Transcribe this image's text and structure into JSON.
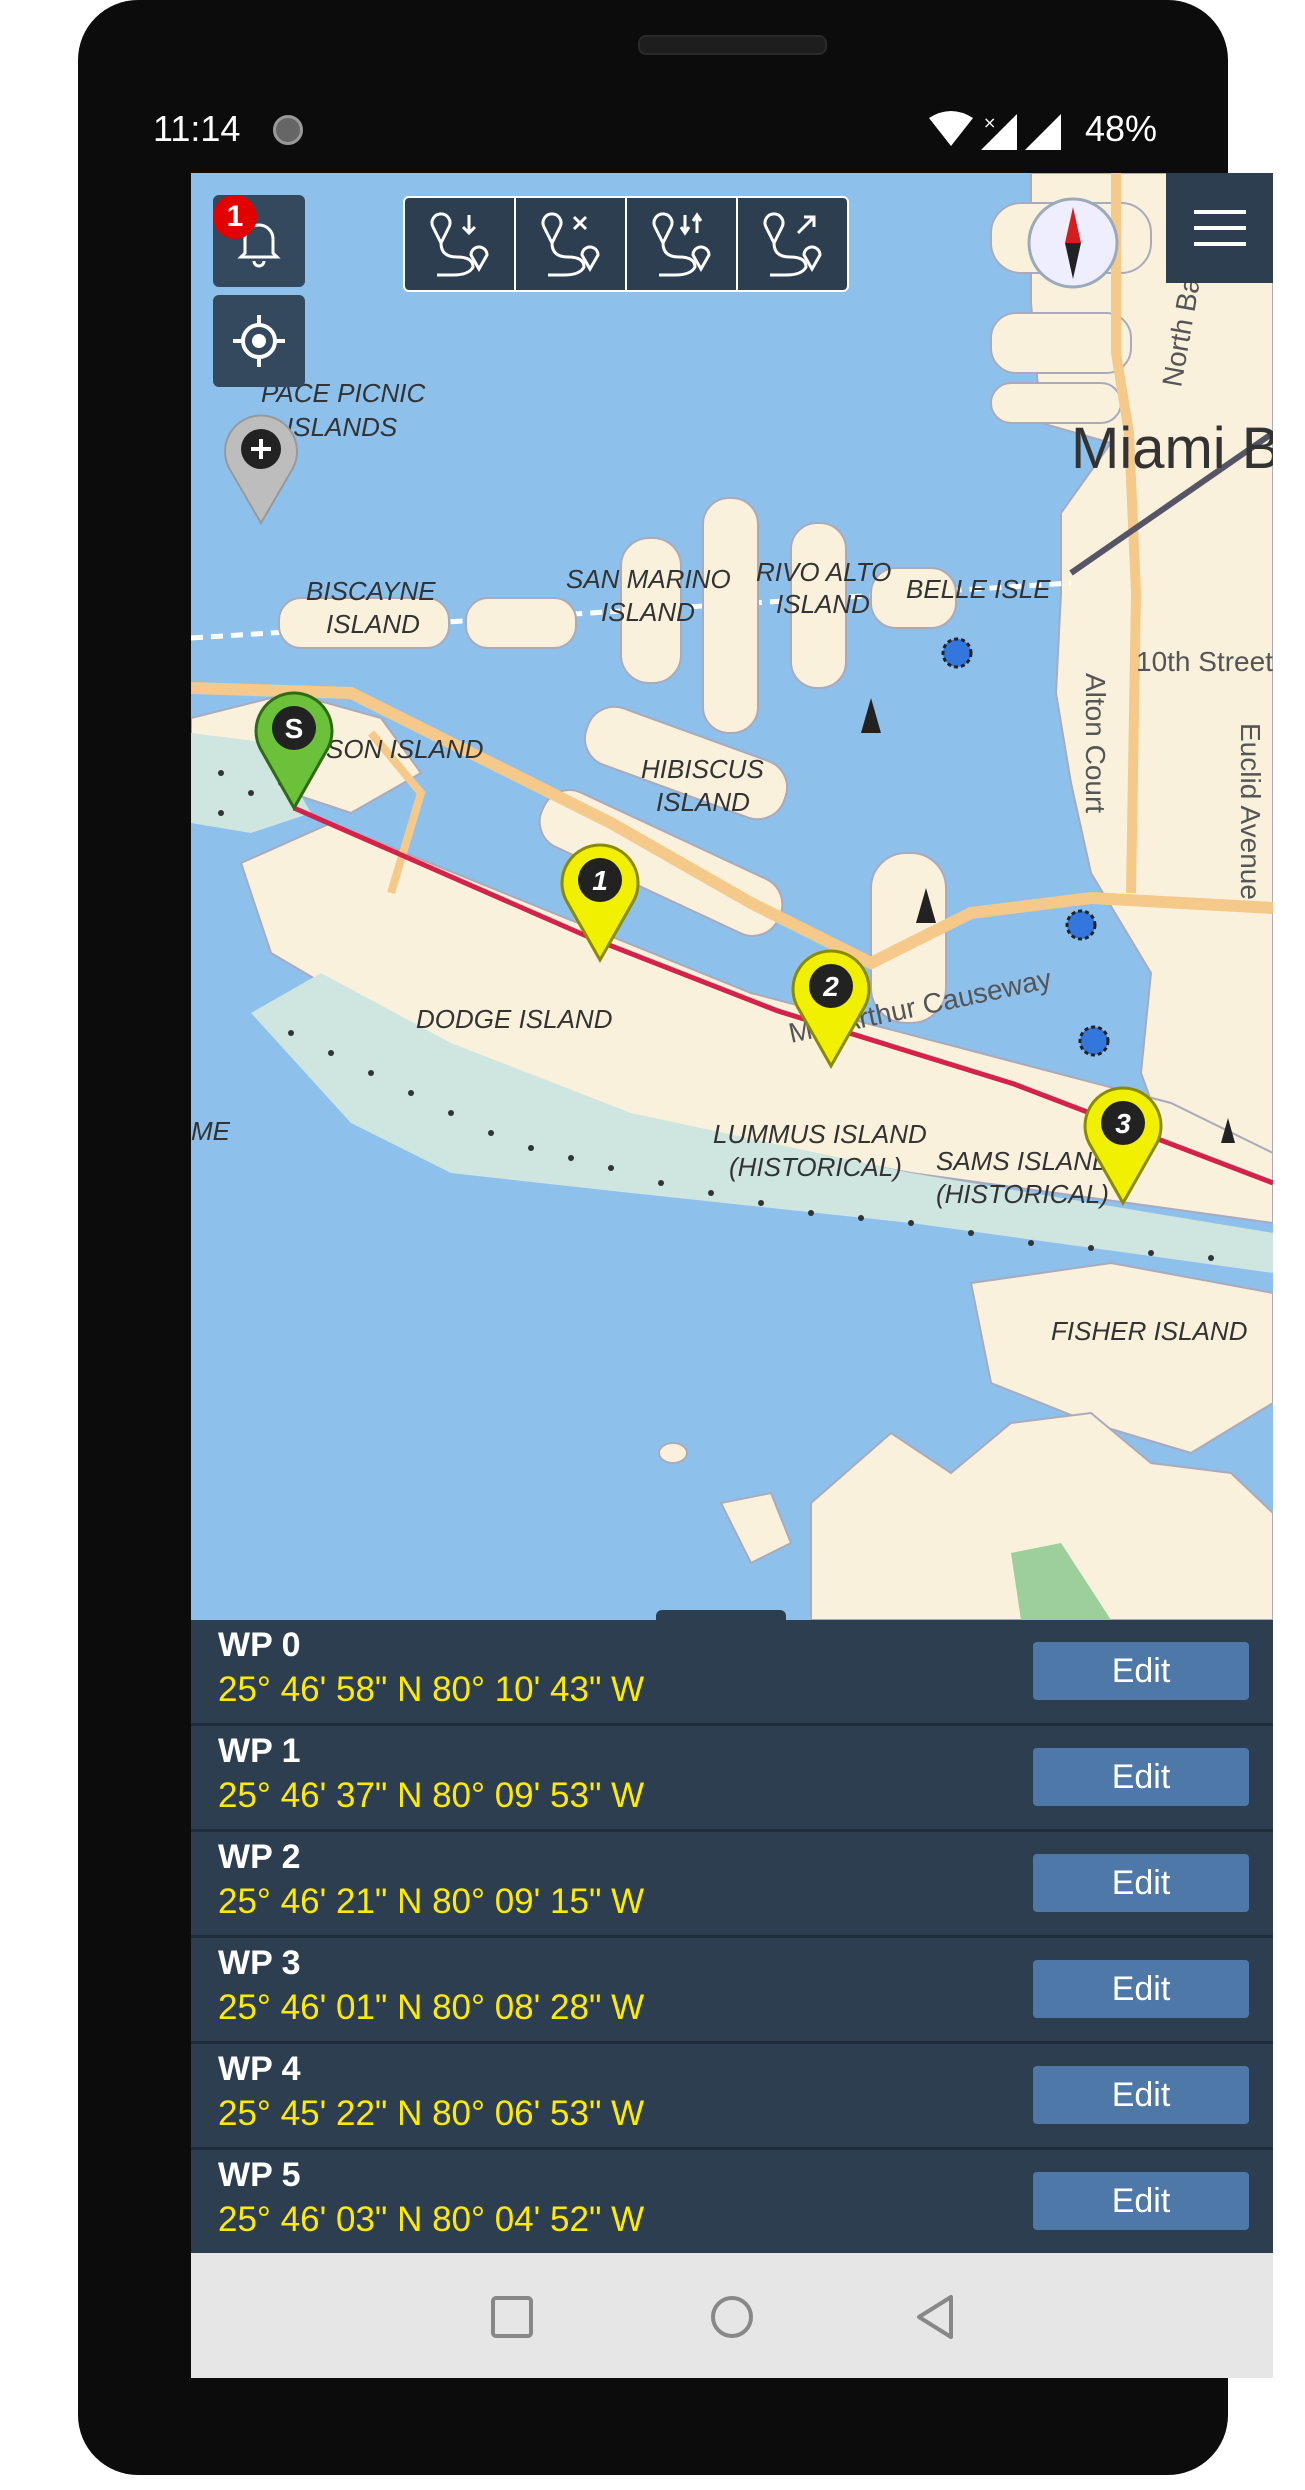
{
  "status_bar": {
    "time": "11:14",
    "battery": "48%"
  },
  "notifications": {
    "count": "1"
  },
  "toolbar": {
    "buttons": [
      {
        "icon": "route-add-waypoint-icon"
      },
      {
        "icon": "route-delete-waypoint-icon"
      },
      {
        "icon": "route-reorder-icon"
      },
      {
        "icon": "route-share-icon"
      }
    ]
  },
  "map": {
    "labels": {
      "pace_picnic": "PACE PICNIC",
      "islands": "ISLANDS",
      "biscayne": "BISCAYNE",
      "biscayne_island": "ISLAND",
      "san_marino": "SAN MARINO",
      "san_marino_island": "ISLAND",
      "rivo_alto": "RIVO ALTO",
      "rivo_alto_island": "ISLAND",
      "belle_isle": "BELLE ISLE",
      "watson_island": "SON ISLAND",
      "hibiscus": "HIBISCUS",
      "hibiscus_island": "ISLAND",
      "dodge_island": "DODGE ISLAND",
      "lummus": "LUMMUS ISLAND",
      "lummus_hist": "(HISTORICAL)",
      "sams": "SAMS ISLAND",
      "sams_hist": "(HISTORICAL)",
      "fisher_island": "FISHER ISLAND",
      "me": "ME",
      "miami": "Miami B",
      "north_bay": "North Bay R",
      "alton_court": "Alton Court",
      "euclid": "Euclid Avenue",
      "tenth_street": "10th Street",
      "macarthur": "MacArthur Causeway"
    },
    "markers": [
      {
        "label": "S",
        "color": "#6cc13a"
      },
      {
        "label": "1",
        "color": "#f0f000"
      },
      {
        "label": "2",
        "color": "#f0f000"
      },
      {
        "label": "3",
        "color": "#f0f000"
      }
    ],
    "colors": {
      "water": "#8ec0ec",
      "land": "#f9f1dc",
      "route": "#d4224a",
      "road": "#f5c98a"
    }
  },
  "waypoints": [
    {
      "name": "WP 0",
      "coord": "25° 46' 58\" N 80° 10' 43\" W",
      "action": "Edit"
    },
    {
      "name": "WP 1",
      "coord": "25° 46' 37\" N 80° 09' 53\" W",
      "action": "Edit"
    },
    {
      "name": "WP 2",
      "coord": "25° 46' 21\" N 80° 09' 15\" W",
      "action": "Edit"
    },
    {
      "name": "WP 3",
      "coord": "25° 46' 01\" N 80° 08' 28\" W",
      "action": "Edit"
    },
    {
      "name": "WP 4",
      "coord": "25° 45' 22\" N 80° 06' 53\" W",
      "action": "Edit"
    },
    {
      "name": "WP 5",
      "coord": "25° 46' 03\" N 80° 04' 52\" W",
      "action": "Edit"
    }
  ]
}
